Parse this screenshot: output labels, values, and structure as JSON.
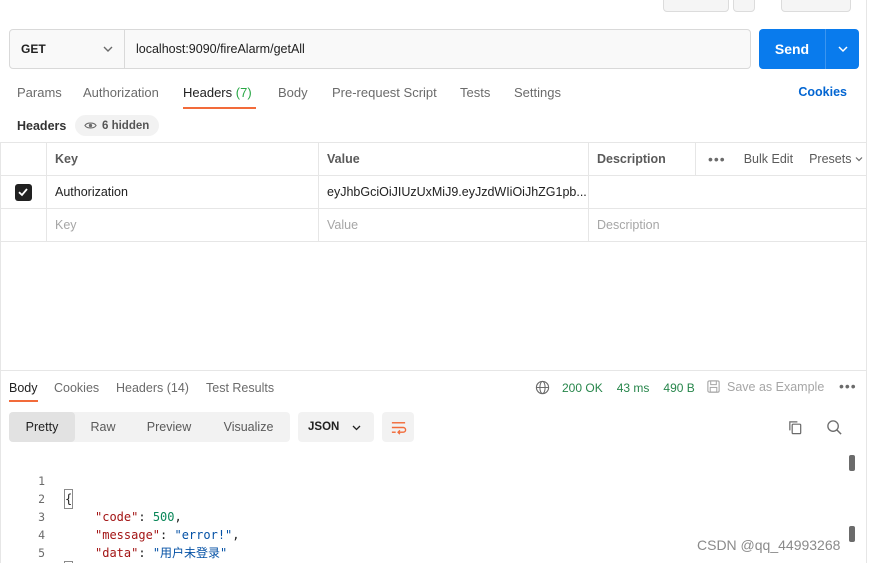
{
  "request": {
    "method": "GET",
    "url": "localhost:9090/fireAlarm/getAll",
    "send_label": "Send"
  },
  "request_tabs": [
    {
      "label": "Params"
    },
    {
      "label": "Authorization"
    },
    {
      "label": "Headers",
      "count": "(7)"
    },
    {
      "label": "Body"
    },
    {
      "label": "Pre-request Script"
    },
    {
      "label": "Tests"
    },
    {
      "label": "Settings"
    }
  ],
  "cookies_label": "Cookies",
  "headers_section": {
    "title": "Headers",
    "hidden_label": "6 hidden",
    "columns": {
      "key": "Key",
      "value": "Value",
      "description": "Description"
    },
    "bulk_edit_label": "Bulk Edit",
    "presets_label": "Presets",
    "rows": [
      {
        "checked": true,
        "key": "Authorization",
        "value": "eyJhbGciOiJIUzUxMiJ9.eyJzdWIiOiJhZG1pb..."
      }
    ],
    "empty_row": {
      "key": "Key",
      "value": "Value",
      "description": "Description"
    }
  },
  "response_tabs": [
    {
      "label": "Body"
    },
    {
      "label": "Cookies"
    },
    {
      "label": "Headers",
      "count": "(14)"
    },
    {
      "label": "Test Results"
    }
  ],
  "response_status": {
    "status": "200 OK",
    "time": "43 ms",
    "size": "490 B",
    "save_label": "Save as Example"
  },
  "view_modes": [
    "Pretty",
    "Raw",
    "Preview",
    "Visualize"
  ],
  "format": "JSON",
  "code_lines": [
    {
      "no": "1",
      "text": "{"
    },
    {
      "no": "2",
      "key": "\"code\"",
      "sep": ": ",
      "val": "500",
      "trail": ","
    },
    {
      "no": "3",
      "key": "\"message\"",
      "sep": ": ",
      "val": "\"error!\"",
      "trail": ","
    },
    {
      "no": "4",
      "key": "\"data\"",
      "sep": ": ",
      "val": "\"用户未登录\"",
      "trail": ""
    },
    {
      "no": "5",
      "text": "}"
    }
  ],
  "watermark": "CSDN @qq_44993268",
  "colors": {
    "accent": "#097bed",
    "tab_underline": "#f26b3a",
    "status_green": "#27864b"
  }
}
